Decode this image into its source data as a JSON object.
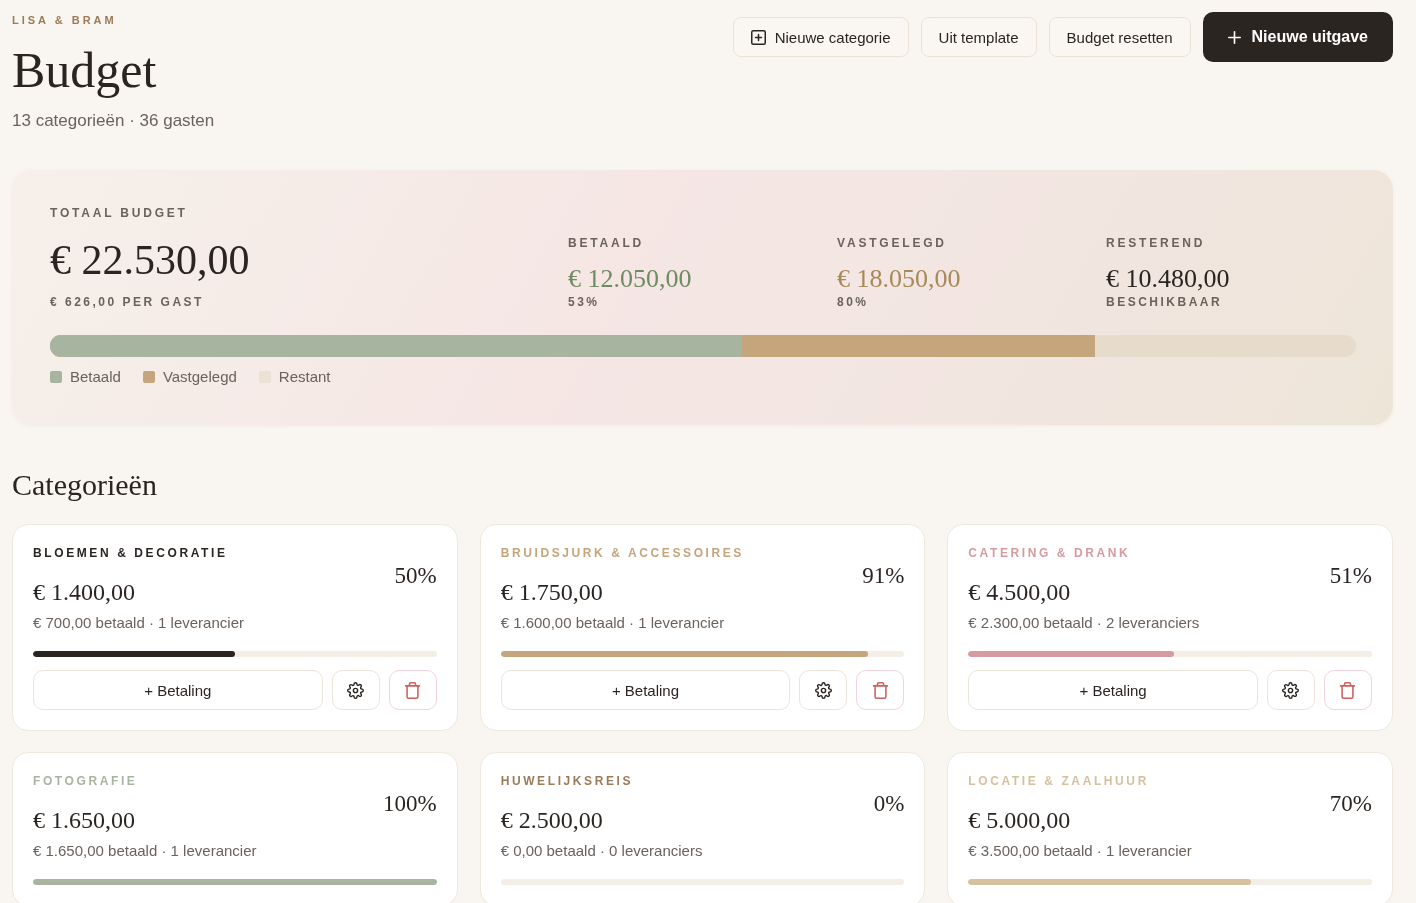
{
  "header": {
    "eyebrow": "LISA & BRAM",
    "title": "Budget",
    "subtitle": "13 categorieën · 36 gasten"
  },
  "toolbar": [
    {
      "label": "Nieuwe categorie",
      "kind": "create"
    },
    {
      "label": "Uit template",
      "kind": "plain"
    },
    {
      "label": "Budget resetten",
      "kind": "plain"
    },
    {
      "label": "Nieuwe uitgave",
      "kind": "primary"
    }
  ],
  "summary": {
    "label": "TOTAAL BUDGET",
    "total": "€ 22.530,00",
    "per_guest": "€ 626,00 PER GAST",
    "stats": [
      {
        "label": "BETAALD",
        "value": "€ 12.050,00",
        "note": "53%",
        "color": "#6e8b63"
      },
      {
        "label": "VASTGELEGD",
        "value": "€ 18.050,00",
        "note": "80%",
        "color": "#a8895a"
      },
      {
        "label": "RESTEREND",
        "value": "€ 10.480,00",
        "note": "BESCHIKBAAR",
        "color": "#2b2522"
      }
    ],
    "bar": [
      {
        "level": 0.53,
        "color": "#a7b5a0"
      },
      {
        "level": 0.8,
        "color": "#c4a57c"
      }
    ],
    "legend": [
      {
        "label": "Betaald",
        "color": "#a7b5a0"
      },
      {
        "label": "Vastgelegd",
        "color": "#c4a57c"
      },
      {
        "label": "Restant",
        "color": "#ebe1d5"
      }
    ]
  },
  "categories": {
    "title": "Categorieën",
    "items": [
      {
        "name": "BLOEMEN & DECORATIE",
        "color": "#2b2522",
        "amount": "€ 1.400,00",
        "percent": "50%",
        "meta": "€ 700,00 betaald · 1 leverancier",
        "level": 0.5,
        "action": "+ Betaling"
      },
      {
        "name": "BRUIDSJURK & ACCESSOIRES",
        "color": "#c4a57c",
        "amount": "€ 1.750,00",
        "percent": "91%",
        "meta": "€ 1.600,00 betaald · 1 leverancier",
        "level": 0.91,
        "action": "+ Betaling"
      },
      {
        "name": "CATERING & DRANK",
        "color": "#d69ba1",
        "amount": "€ 4.500,00",
        "percent": "51%",
        "meta": "€ 2.300,00 betaald · 2 leveranciers",
        "level": 0.51,
        "action": "+ Betaling"
      },
      {
        "name": "FOTOGRAFIE",
        "color": "#a7b5a0",
        "amount": "€ 1.650,00",
        "percent": "100%",
        "meta": "€ 1.650,00 betaald · 1 leverancier",
        "level": 1
      },
      {
        "name": "HUWELIJKSREIS",
        "color": "#9b7b5a",
        "amount": "€ 2.500,00",
        "percent": "0%",
        "meta": "€ 0,00 betaald · 0 leveranciers",
        "level": 0
      },
      {
        "name": "LOCATIE & ZAALHUUR",
        "color": "#d5c19f",
        "amount": "€ 5.000,00",
        "percent": "70%",
        "meta": "€ 3.500,00 betaald · 1 leverancier",
        "level": 0.7
      }
    ]
  }
}
